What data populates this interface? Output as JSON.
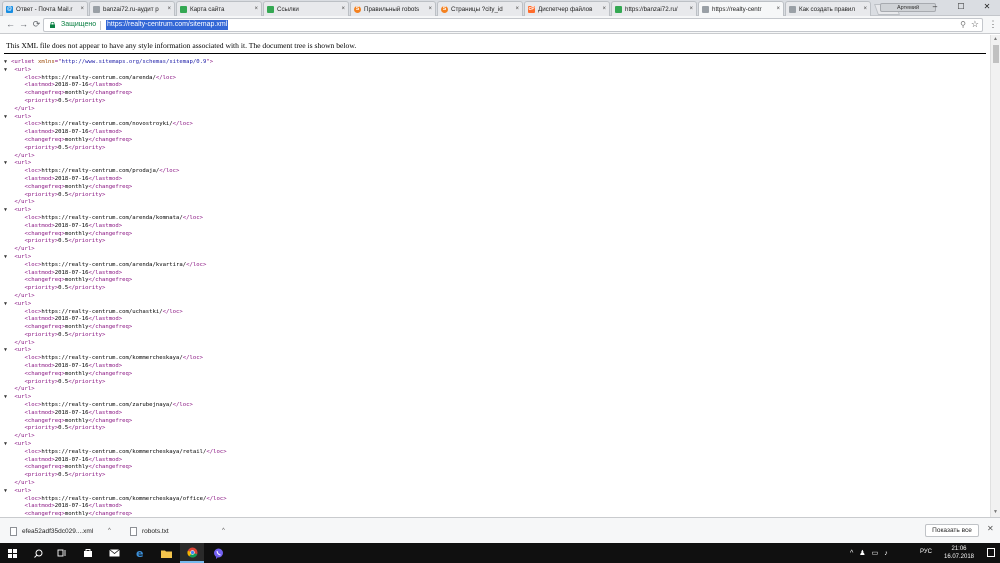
{
  "browser": {
    "tabs": [
      {
        "title": "Ответ - Почта Mail.r",
        "icon": "mail-ru-icon",
        "color": "#168de2",
        "glyph": "@",
        "active": false
      },
      {
        "title": "banzai72.ru-аудит р",
        "icon": "document-icon",
        "color": "#9aa0a6",
        "glyph": "",
        "active": false
      },
      {
        "title": "Карта сайта",
        "icon": "green-square-icon",
        "color": "#34a853",
        "glyph": "",
        "active": false
      },
      {
        "title": "Ссылки",
        "icon": "green-square-icon",
        "color": "#34a853",
        "glyph": "",
        "active": false
      },
      {
        "title": "Правильный robots",
        "icon": "orange-circle-icon",
        "color": "#f4811f",
        "glyph": "S",
        "active": false
      },
      {
        "title": "Страницы ?city_id",
        "icon": "orange-circle-icon",
        "color": "#f4811f",
        "glyph": "S",
        "active": false
      },
      {
        "title": "Диспетчер файлов",
        "icon": "cp-icon",
        "color": "#ff6c2c",
        "glyph": "cP",
        "active": false
      },
      {
        "title": "https://banzai72.ru/",
        "icon": "green-square-icon",
        "color": "#34a853",
        "glyph": "",
        "active": false
      },
      {
        "title": "https://realty-centr",
        "icon": "document-icon",
        "color": "#9aa0a6",
        "glyph": "",
        "active": true
      },
      {
        "title": "Как создать правил",
        "icon": "document-icon",
        "color": "#9aa0a6",
        "glyph": "",
        "active": false
      }
    ],
    "tab_close": "×",
    "profile_label": "Артемий",
    "window": {
      "minimize": "–",
      "maximize": "☐",
      "close": "✕"
    },
    "nav": {
      "back": "←",
      "forward": "→",
      "reload": "⟳"
    },
    "secure_label": "Защищено",
    "url": "https://realty-centrum.com/sitemap.xml",
    "zoom_icon": "⚲",
    "star_icon": "☆",
    "menu_icon": "⋮"
  },
  "page": {
    "info_message": "This XML file does not appear to have any style information associated with it. The document tree is shown below.",
    "toggle_glyph": "▼",
    "root": {
      "tag": "urlset",
      "attr_name": "xmlns",
      "attr_value": "http://www.sitemaps.org/schemas/sitemap/0.9"
    },
    "urls": [
      {
        "loc": "https://realty-centrum.com/arenda/",
        "lastmod": "2018-07-16",
        "changefreq": "monthly",
        "priority": "0.5"
      },
      {
        "loc": "https://realty-centrum.com/novostroyki/",
        "lastmod": "2018-07-16",
        "changefreq": "monthly",
        "priority": "0.5"
      },
      {
        "loc": "https://realty-centrum.com/prodaja/",
        "lastmod": "2018-07-16",
        "changefreq": "monthly",
        "priority": "0.5"
      },
      {
        "loc": "https://realty-centrum.com/arenda/komnata/",
        "lastmod": "2018-07-16",
        "changefreq": "monthly",
        "priority": "0.5"
      },
      {
        "loc": "https://realty-centrum.com/arenda/kvartira/",
        "lastmod": "2018-07-16",
        "changefreq": "monthly",
        "priority": "0.5"
      },
      {
        "loc": "https://realty-centrum.com/uchastki/",
        "lastmod": "2018-07-16",
        "changefreq": "monthly",
        "priority": "0.5"
      },
      {
        "loc": "https://realty-centrum.com/kommercheskaya/",
        "lastmod": "2018-07-16",
        "changefreq": "monthly",
        "priority": "0.5"
      },
      {
        "loc": "https://realty-centrum.com/zarubejnaya/",
        "lastmod": "2018-07-16",
        "changefreq": "monthly",
        "priority": "0.5"
      },
      {
        "loc": "https://realty-centrum.com/kommercheskaya/retail/",
        "lastmod": "2018-07-16",
        "changefreq": "monthly",
        "priority": "0.5"
      },
      {
        "loc": "https://realty-centrum.com/kommercheskaya/office/",
        "lastmod": "2018-07-16",
        "changefreq": "monthly",
        "priority": ""
      }
    ]
  },
  "downloads": {
    "items": [
      {
        "name": "efea52adf35dc029....xml"
      },
      {
        "name": "robots.txt"
      }
    ],
    "caret": "^",
    "show_all": "Показать все",
    "close": "✕"
  },
  "taskbar": {
    "lang": "РУС",
    "time": "21:06",
    "date": "16.07.2018",
    "tray_caret": "^"
  }
}
